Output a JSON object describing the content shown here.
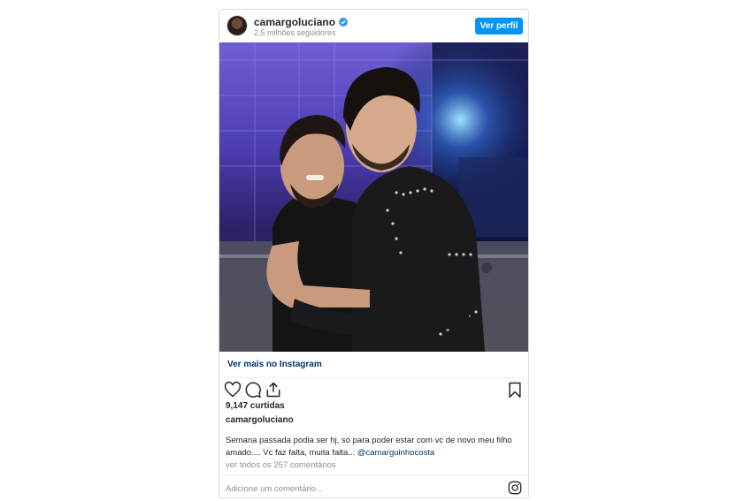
{
  "header": {
    "username": "camargoluciano",
    "followers": "2,5 milhões seguidores",
    "profile_button": "Ver perfil"
  },
  "post": {
    "view_more_link": "Ver mais no Instagram",
    "likes": "9,147 curtidas",
    "caption_username": "camargoluciano",
    "caption_text": "Semana passada podia ser hj, só para poder estar com vc de novo meu filho amado.... Vc faz falta, muita falta... ",
    "caption_mention": "@camarguinhocosta",
    "view_comments": "ver todos os 257 comentários",
    "add_comment_placeholder": "Adicione um comentário..."
  },
  "icons": {
    "like": "heart-icon",
    "comment": "comment-icon",
    "share": "share-icon",
    "save": "bookmark-icon",
    "instagram": "instagram-icon",
    "verified": "verified-badge-icon"
  },
  "colors": {
    "accent": "#0095f6",
    "link": "#00376b",
    "muted": "#8e8e8e"
  }
}
